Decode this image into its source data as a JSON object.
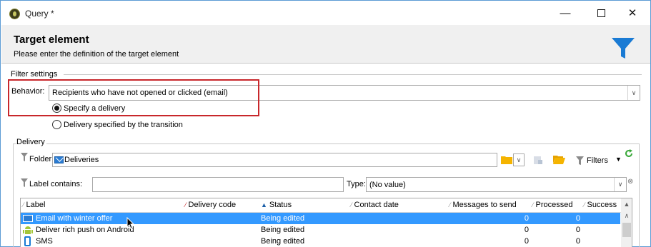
{
  "window": {
    "title": "Query *"
  },
  "header": {
    "title": "Target element",
    "subtitle": "Please enter the definition of the target element"
  },
  "filter_settings": {
    "section_label": "Filter settings",
    "behavior_label": "Behavior:",
    "behavior_value": "Recipients who have not opened or clicked (email)",
    "radio_specify": "Specify a delivery",
    "radio_transition": "Delivery specified by the transition",
    "selected_radio": "Specify a delivery"
  },
  "delivery": {
    "section_label": "Delivery",
    "folder_label": "Folder:",
    "folder_value": "Deliveries",
    "filters_label": "Filters",
    "label_contains": "Label contains:",
    "label_contains_value": "",
    "type_label": "Type:",
    "type_value": "(No value)"
  },
  "table": {
    "columns": [
      "Label",
      "Delivery code",
      "Status",
      "Contact date",
      "Messages to send",
      "Processed",
      "Success"
    ],
    "rows": [
      {
        "label": "Email with winter offer",
        "code": "",
        "status": "Being edited",
        "contact": "",
        "to_send": "0",
        "processed": "0",
        "icon": "email-icon",
        "selected": true
      },
      {
        "label": "Deliver rich push on Android",
        "code": "",
        "status": "Being edited",
        "contact": "",
        "to_send": "0",
        "processed": "0",
        "icon": "android-icon",
        "selected": false
      },
      {
        "label": "SMS",
        "code": "",
        "status": "Being edited",
        "contact": "",
        "to_send": "0",
        "processed": "0",
        "icon": "mobile-phone-icon",
        "selected": false
      }
    ]
  },
  "colors": {
    "accent": "#1a7bd4",
    "selection": "#3399ff",
    "highlight_box": "#c8272b",
    "header_bg": "#f0f0f0"
  }
}
